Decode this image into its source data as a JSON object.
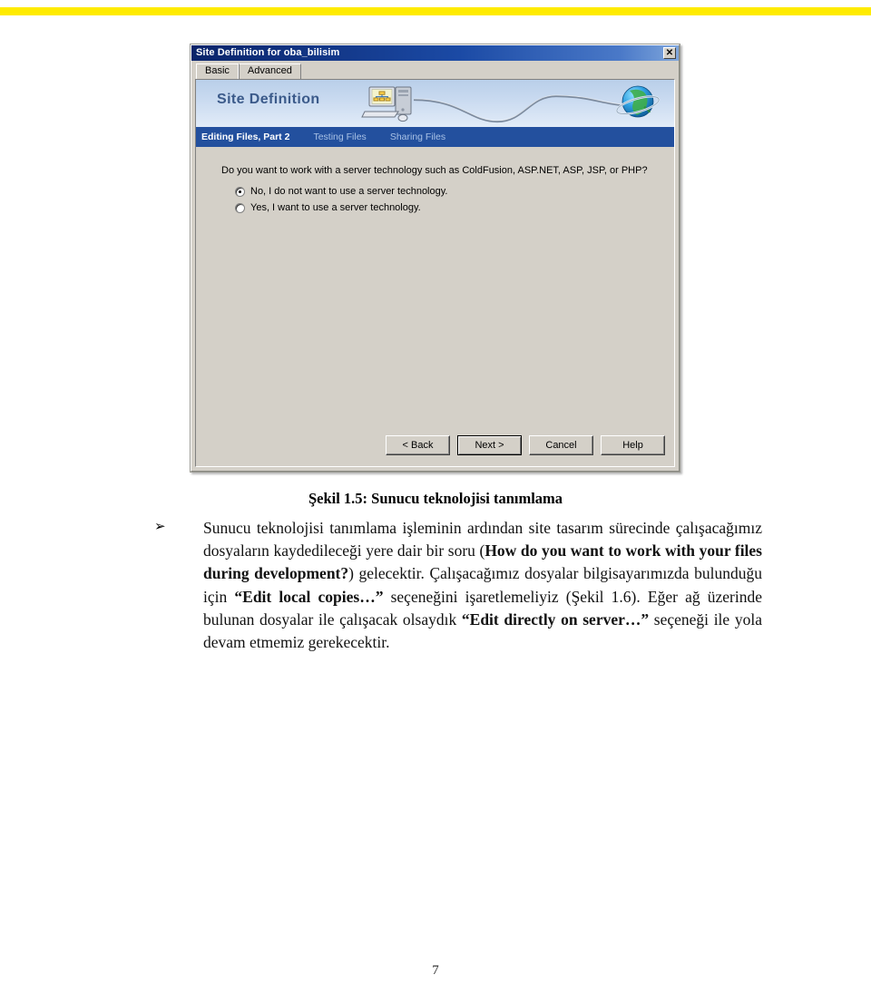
{
  "document": {
    "page_number": "7",
    "figure_caption": "Şekil 1.5: Sunucu teknolojisi tanımlama",
    "bullet_glyph": "➢",
    "paragraph": {
      "segments": [
        {
          "text": "Sunucu teknolojisi tanımlama işleminin ardından site tasarım sürecinde çalışacağımız dosyaların kaydedileceği yere dair bir soru (",
          "bold": false
        },
        {
          "text": "How do you want to work with your files during development?",
          "bold": true
        },
        {
          "text": ") gelecektir. Çalışacağımız dosyalar bilgisayarımızda bulunduğu için ",
          "bold": false
        },
        {
          "text": "“Edit local copies…”",
          "bold": true
        },
        {
          "text": " seçeneğini işaretlemeliyiz (Şekil 1.6). Eğer ağ üzerinde bulunan dosyalar ile çalışacak olsaydık ",
          "bold": false
        },
        {
          "text": "“Edit directly on server…”",
          "bold": true
        },
        {
          "text": " seçeneği ile yola devam etmemiz gerekecektir.",
          "bold": false
        }
      ]
    },
    "accent_rule_color": "#ffeb00"
  },
  "dialog": {
    "title": "Site Definition for oba_bilisim",
    "close_label": "✕",
    "tabs": [
      {
        "label": "Basic",
        "selected": true
      },
      {
        "label": "Advanced",
        "selected": false
      }
    ],
    "banner": {
      "heading": "Site Definition",
      "artwork": "computer-to-globe-illustration"
    },
    "steps": [
      {
        "label": "Editing Files, Part 2",
        "active": true
      },
      {
        "label": "Testing Files",
        "active": false
      },
      {
        "label": "Sharing Files",
        "active": false
      }
    ],
    "question": "Do you want to work with a server technology such as ColdFusion, ASP.NET, ASP, JSP, or PHP?",
    "options": [
      {
        "label": "No, I do not want to use a server technology.",
        "selected": true
      },
      {
        "label": "Yes, I want to use a server technology.",
        "selected": false
      }
    ],
    "buttons": [
      {
        "label": "< Back",
        "default": false
      },
      {
        "label": "Next >",
        "default": true
      },
      {
        "label": "Cancel",
        "default": false
      },
      {
        "label": "Help",
        "default": false
      }
    ],
    "colors": {
      "titlebar": "#0a246a",
      "steps_bar": "#23509e",
      "banner_heading": "#3b5a8a",
      "face": "#d4d0c8"
    }
  }
}
